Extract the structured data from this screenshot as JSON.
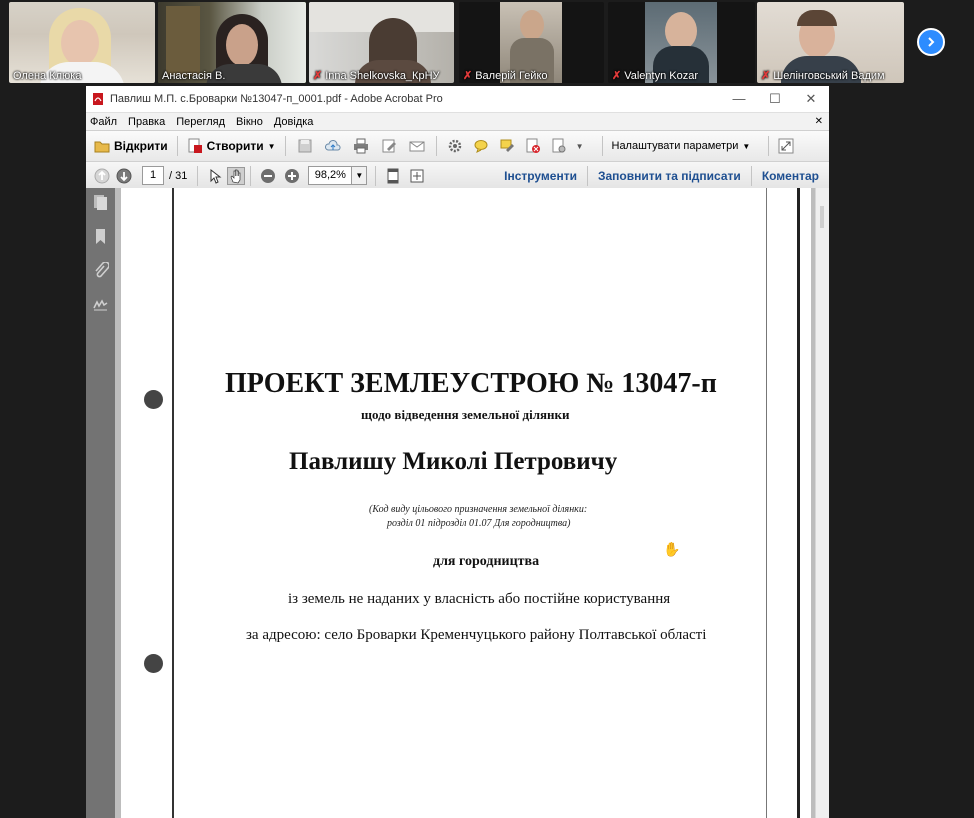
{
  "participants": [
    {
      "name": "Олена Клюка",
      "muted": false,
      "active": false
    },
    {
      "name": "Анастасія В.",
      "muted": false,
      "active": true
    },
    {
      "name": "Inna Shelkovska_КрНУ",
      "muted": true,
      "active": false
    },
    {
      "name": "Валерій Гейко",
      "muted": true,
      "active": false
    },
    {
      "name": "Valentyn Kozar",
      "muted": true,
      "active": false
    },
    {
      "name": "Шелінговський Вадим",
      "muted": true,
      "active": false
    }
  ],
  "acrobat": {
    "title": "Павлиш М.П. с.Броварки №13047-п_0001.pdf - Adobe Acrobat Pro",
    "menu": [
      "Файл",
      "Правка",
      "Перегляд",
      "Вікно",
      "Довідка"
    ],
    "toolbar": {
      "open_label": "Відкрити",
      "create_label": "Створити",
      "customize_label": "Налаштувати параметри"
    },
    "nav": {
      "current_page": "1",
      "total_pages": "/ 31",
      "zoom": "98,2%"
    },
    "panels": {
      "tools": "Інструменти",
      "fill_sign": "Заповнити та підписати",
      "comment": "Коментар"
    }
  },
  "document": {
    "title": "ПРОЕКТ ЗЕМЛЕУСТРОЮ № 13047-п",
    "subtitle": "щодо відведення земельної ділянки",
    "name": "Павлишу Миколі Петровичу",
    "code_line1": "(Код виду цільового призначення земельної ділянки:",
    "code_line2": "розділ 01 підрозділ 01.07 Для городництва)",
    "purpose": "для городництва",
    "land_source": "із земель не наданих у власність або постійне користування",
    "address": "за адресою: село Броварки Кременчуцького району Полтавської області"
  }
}
